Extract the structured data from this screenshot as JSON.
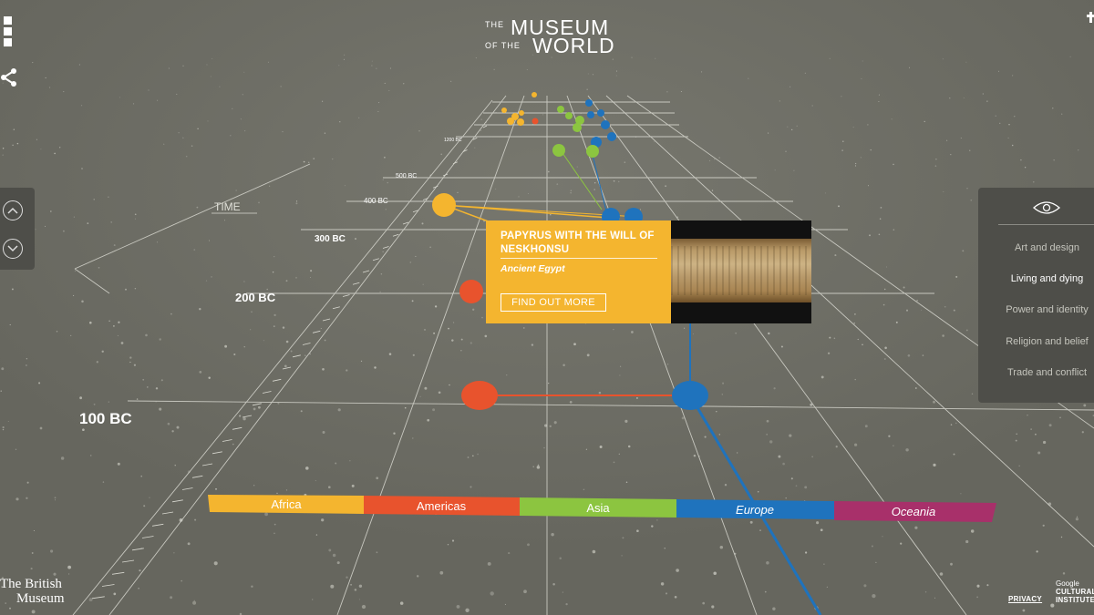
{
  "header": {
    "logo_the": "THE",
    "logo_museum": "MUSEUM",
    "logo_of_the": "OF THE",
    "logo_world": "WORLD"
  },
  "timeline": {
    "axis_label": "TIME",
    "dates": [
      "1200 BC",
      "500 BC",
      "400 BC",
      "300 BC",
      "200 BC",
      "100 BC"
    ]
  },
  "regions": [
    {
      "name": "Africa",
      "color": "#f4b52f"
    },
    {
      "name": "Americas",
      "color": "#e8532d"
    },
    {
      "name": "Asia",
      "color": "#8cc540"
    },
    {
      "name": "Europe",
      "color": "#1f73bd"
    },
    {
      "name": "Oceania",
      "color": "#a8306a"
    }
  ],
  "popup": {
    "title": "PAPYRUS WITH THE WILL OF NESKHONSU",
    "subtitle": "Ancient Egypt",
    "button": "FIND OUT MORE"
  },
  "filters": {
    "icon": "eye-icon",
    "items": [
      "Art and design",
      "Living and dying",
      "Power and identity",
      "Religion and belief",
      "Trade and conflict"
    ],
    "active": "Living and dying"
  },
  "footer": {
    "bm_line1": "The British",
    "bm_line2": "Museum",
    "privacy": "PRIVACY",
    "google_line1": "Google",
    "google_line2": "CULTURAL",
    "google_line3": "INSTITUTE"
  },
  "colors": {
    "background": "#6b6b63",
    "panel": "#4e4e49",
    "africa": "#f4b52f",
    "americas": "#e8532d",
    "asia": "#8cc540",
    "europe": "#1f73bd",
    "oceania": "#a8306a"
  }
}
